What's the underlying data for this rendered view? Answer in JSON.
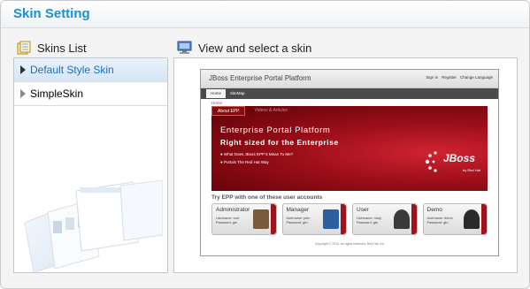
{
  "title": "Skin Setting",
  "skins_list": {
    "header": "Skins List",
    "items": [
      {
        "label": "Default Style Skin",
        "selected": true
      },
      {
        "label": "SimpleSkin",
        "selected": false
      }
    ]
  },
  "preview": {
    "header": "View and select a skin",
    "screenshot": {
      "brand": "JBoss Enterprise Portal Platform",
      "top_links": [
        "Sign in",
        "Register",
        "Change Language"
      ],
      "nav_tabs": [
        "Home",
        "SiteMap"
      ],
      "breadcrumb": "Home",
      "banner_tabs": [
        "About EPP",
        "Videos & Articles"
      ],
      "banner_title": "Enterprise Portal Platform",
      "banner_subtitle": "Right sized for the Enterprise",
      "banner_bullets": [
        "What Does JBoss EPP 5 Mean To Me?",
        "Portals The Red Hat Way"
      ],
      "logo_text": "JBoss",
      "logo_sub": "by Red Hat",
      "try_text": "Try EPP with one of these user accounts",
      "accounts": [
        {
          "title": "Administrator",
          "username": "Username: root",
          "password": "Password: gtn",
          "color": "#7a5a3a"
        },
        {
          "title": "Manager",
          "username": "Username: john",
          "password": "Password: gtn",
          "color": "#2a5fa0"
        },
        {
          "title": "User",
          "username": "Username: mary",
          "password": "Password: gtn",
          "color": "#3a3a3a"
        },
        {
          "title": "Demo",
          "username": "Username: demo",
          "password": "Password: gtn",
          "color": "#2a2a2a"
        }
      ],
      "copyright": "Copyright © 2010. All rights reserved, Red Hat, Inc"
    }
  },
  "colors": {
    "title": "#1b8fd6",
    "selected_text": "#1b6fc2",
    "banner": "#9b0e18"
  }
}
